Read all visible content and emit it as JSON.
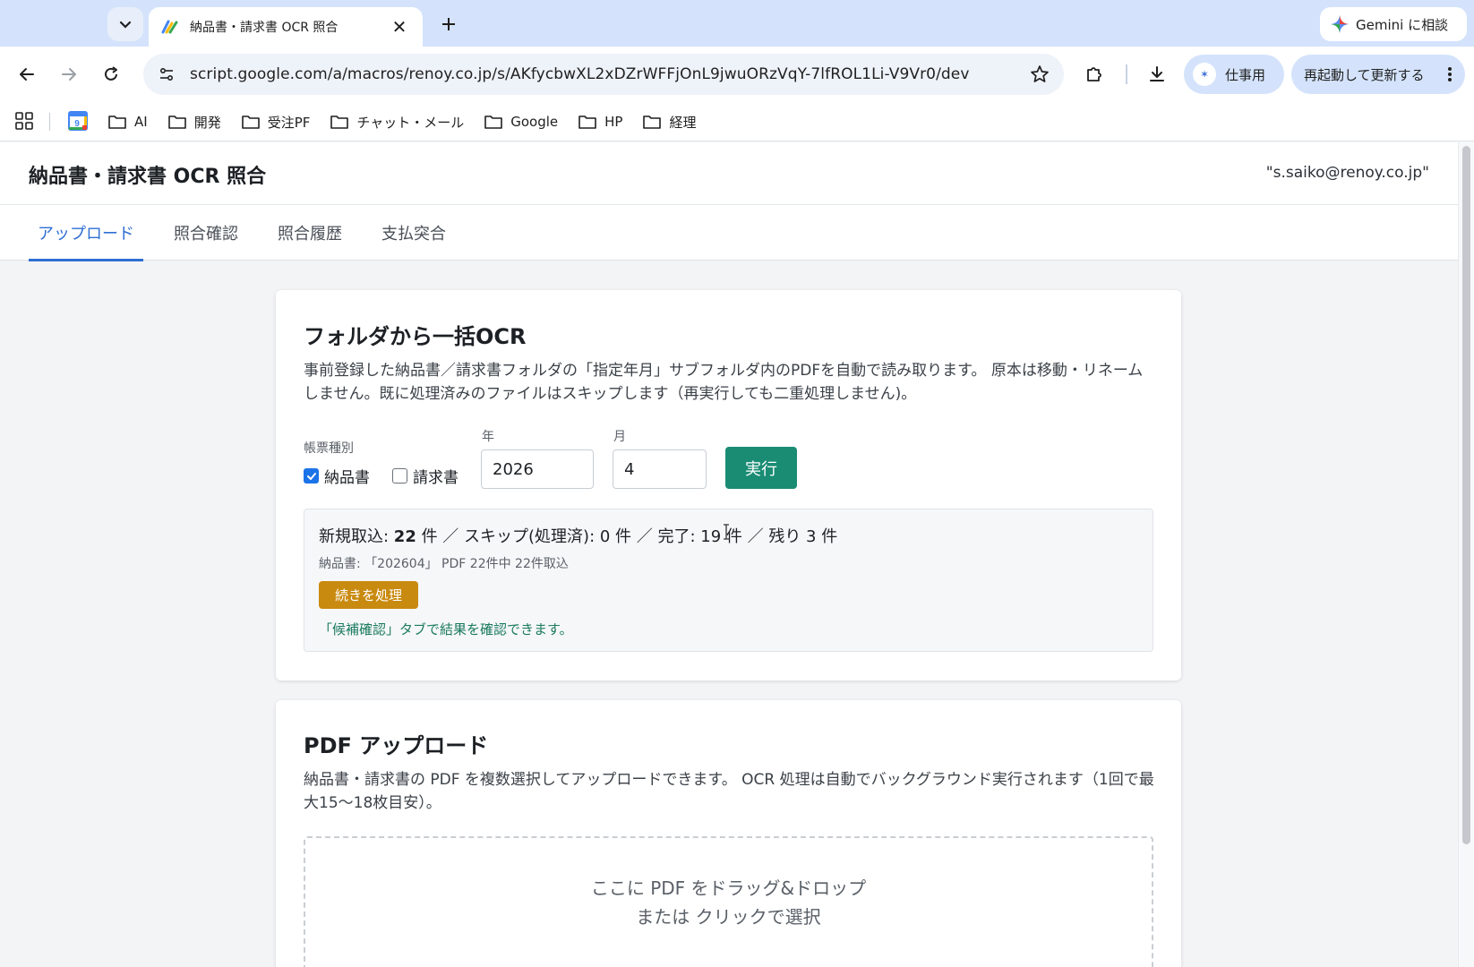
{
  "browser": {
    "tab_title": "納品書・請求書 OCR 照合",
    "gemini_label": "Gemini に相談",
    "url": "script.google.com/a/macros/renoy.co.jp/s/AKfycbwXL2xDZrWFFjOnL9jwuORzVqY-7lfROL1Li-V9Vr0/dev",
    "profile_label": "仕事用",
    "update_label": "再起動して更新する",
    "bookmarks": [
      "AI",
      "開発",
      "受注PF",
      "チャット・メール",
      "Google",
      "HP",
      "経理"
    ],
    "calendar_day": "9"
  },
  "app": {
    "title": "納品書・請求書 OCR 照合",
    "user_email": "\"s.saiko@renoy.co.jp\"",
    "tabs": [
      "アップロード",
      "照合確認",
      "照合履歴",
      "支払突合"
    ]
  },
  "bulk_ocr": {
    "heading": "フォルダから一括OCR",
    "description": "事前登録した納品書／請求書フォルダの「指定年月」サブフォルダ内のPDFを自動で読み取ります。 原本は移動・リネームしません。既に処理済みのファイルはスキップします（再実行しても二重処理しません)。",
    "doc_type_label": "帳票種別",
    "doc_types": [
      {
        "label": "納品書",
        "checked": true
      },
      {
        "label": "請求書",
        "checked": false
      }
    ],
    "year_label": "年",
    "year_value": "2026",
    "month_label": "月",
    "month_value": "4",
    "run_label": "実行",
    "status": {
      "prefix": "新規取込: ",
      "new_count": "22",
      "rest": " 件 ／ スキップ(処理済): 0 件 ／ 完了: 19 件 ／ 残り 3 件",
      "sub": "納品書: 「202604」 PDF 22件中 22件取込",
      "continue_label": "続きを処理",
      "note": "「候補確認」タブで結果を確認できます。"
    }
  },
  "pdf_upload": {
    "heading": "PDF アップロード",
    "description": "納品書・請求書の PDF を複数選択してアップロードできます。 OCR 処理は自動でバックグラウンド実行されます（1回で最大15〜18枚目安）。",
    "drop_line1": "ここに PDF をドラッグ&ドロップ",
    "drop_line2": "または クリックで選択"
  },
  "colors": {
    "accent": "#2f6fd4",
    "run_button": "#1a8c74",
    "continue_button": "#c98a10",
    "note_text": "#1a7a5c"
  }
}
